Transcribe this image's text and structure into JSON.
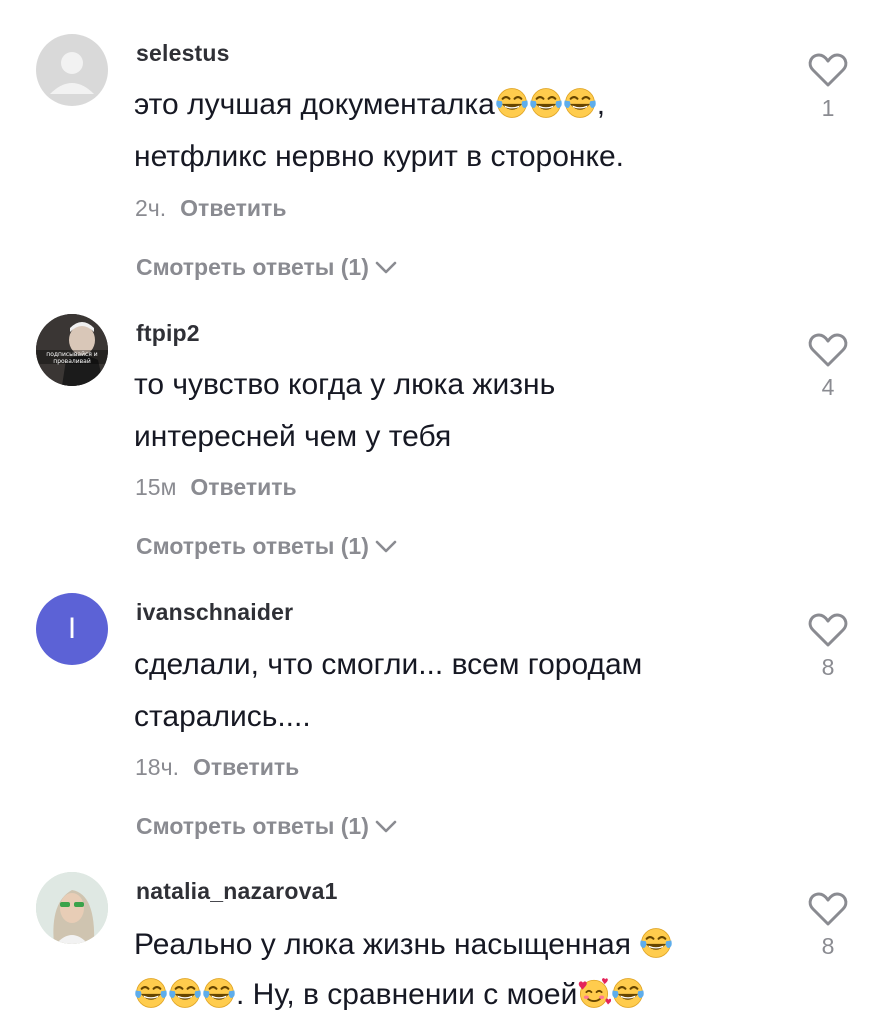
{
  "comments": [
    {
      "username": "selestus",
      "text_line1": "это лучшая документалка",
      "text_line1_suffix": ",",
      "text_line2": "нетфликс нервно курит в сторонке.",
      "time": "2ч.",
      "reply_label": "Ответить",
      "view_replies_label": "Смотреть ответы (1)",
      "likes": "1",
      "avatar": "default-avatar"
    },
    {
      "username": "ftpip2",
      "text_line1": "то чувство когда у люка жизнь",
      "text_line2": "интересней чем у тебя",
      "time": "15м",
      "reply_label": "Ответить",
      "view_replies_label": "Смотреть ответы (1)",
      "likes": "4",
      "avatar": "photo-avatar",
      "avatar_caption": "подписывайся и проваливай"
    },
    {
      "username": "ivanschnaider",
      "text_line1": "сделали, что смогли... всем городам",
      "text_line2": "старались....",
      "time": "18ч.",
      "reply_label": "Ответить",
      "view_replies_label": "Смотреть ответы (1)",
      "likes": "8",
      "avatar": "letter-avatar",
      "avatar_letter": "I",
      "avatar_color": "#5c62d6"
    },
    {
      "username": "natalia_nazarova1",
      "text_line1": "Реально у люка жизнь насыщенная",
      "text_line2": ". Ну, в сравнении с моей",
      "likes": "8",
      "avatar": "photo-avatar"
    }
  ],
  "colors": {
    "text": "#161823",
    "secondary": "#8a8b91",
    "username": "#2f3036"
  },
  "icons": {
    "like": "heart-outline-icon",
    "expand": "chevron-down-icon",
    "emoji_laugh": "face-with-tears-of-joy-icon",
    "emoji_love": "smiling-face-with-hearts-icon"
  }
}
